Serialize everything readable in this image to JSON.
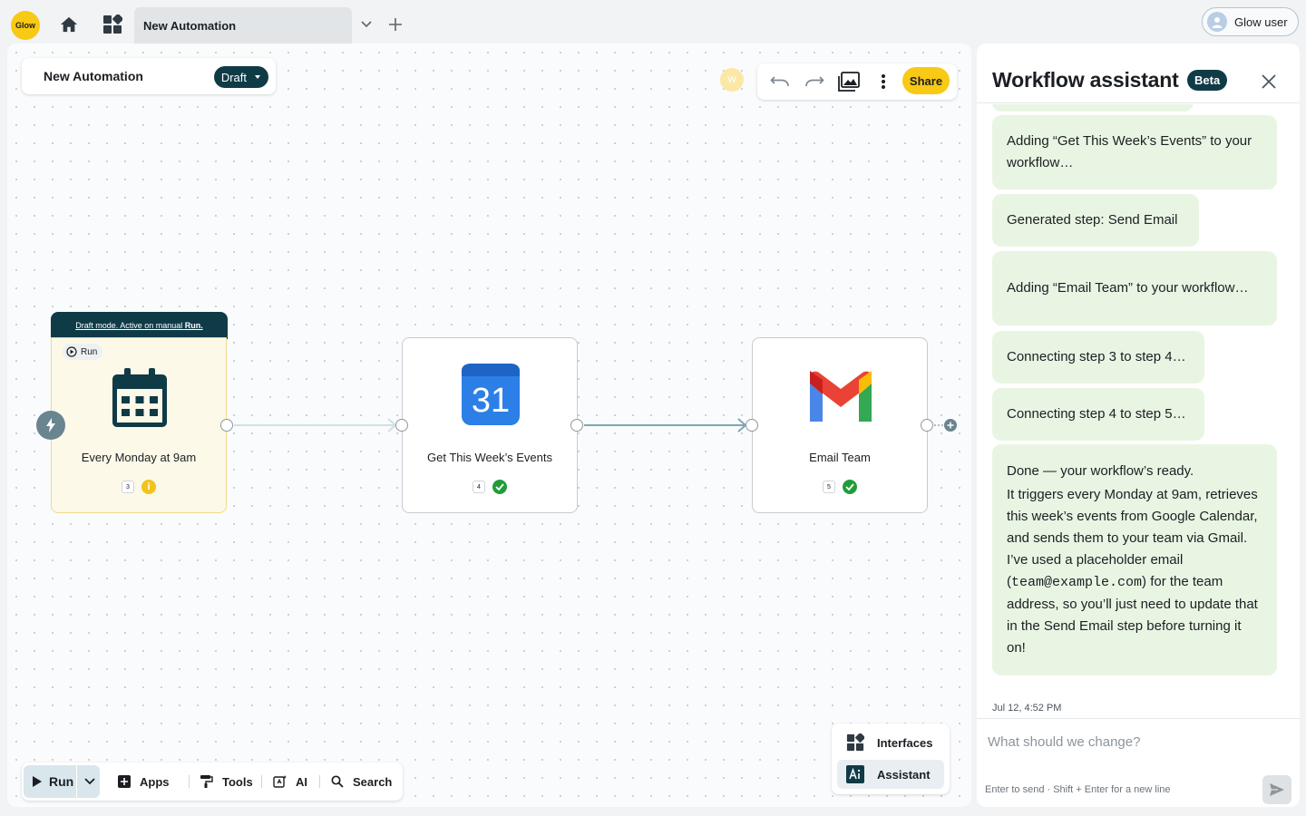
{
  "app": {
    "logo_text": "Glow",
    "tab_title": "New Automation",
    "user_name": "Glow user"
  },
  "canvas": {
    "automation_name": "New Automation",
    "status": "Draft",
    "presence_initial": "W",
    "share_label": "Share",
    "trigger_banner_prefix": "Draft mode. Active on manual ",
    "trigger_banner_link": "Run.",
    "run_chip_label": "Run",
    "nodes": [
      {
        "label": "Every Monday at 9am",
        "step": "3",
        "status": "warning"
      },
      {
        "label": "Get This Week’s Events",
        "step": "4",
        "status": "ok",
        "icon_text": "31"
      },
      {
        "label": "Email Team",
        "step": "5",
        "status": "ok"
      }
    ],
    "warning_glyph": "i"
  },
  "bottom_bar": {
    "run": "Run",
    "apps": "Apps",
    "tools": "Tools",
    "ai": "AI",
    "search": "Search"
  },
  "right_menu": {
    "interfaces": "Interfaces",
    "assistant": "Assistant"
  },
  "assistant": {
    "title": "Workflow assistant",
    "badge": "Beta",
    "messages": [
      "Adding “Get This Week’s Events” to your workflow…",
      "Generated step: Send Email",
      "Adding “Email Team” to your workflow…",
      "Connecting step 3 to step 4…",
      "Connecting step 4 to step 5…"
    ],
    "done": {
      "line1": "Done — your workflow’s ready.",
      "before_code": "It triggers every Monday at 9am, retrieves this week’s events from Google Calendar, and sends them to your team via Gmail. I’ve used a placeholder email (",
      "code": "team@example.com",
      "after_code": ") for the team address, so you’ll just need to update that in the Send Email step before turning it on!"
    },
    "timestamp": "Jul 12, 4:52 PM",
    "input_placeholder": "What should we change?",
    "hint": "Enter to send · Shift + Enter for a new line"
  },
  "colors": {
    "accent_yellow": "#f8c915",
    "dark_teal": "#0f3b47",
    "bubble_green": "#e9f5e3",
    "success_green": "#1f9d3a"
  },
  "icons": [
    "home-icon",
    "apps-grid-icon",
    "chevron-down-icon",
    "plus-icon",
    "user-icon",
    "undo-icon",
    "redo-icon",
    "image-icon",
    "more-vertical-icon",
    "calendar-icon",
    "google-calendar-icon",
    "gmail-icon",
    "bolt-icon",
    "play-icon",
    "search-icon",
    "close-icon",
    "send-icon"
  ]
}
